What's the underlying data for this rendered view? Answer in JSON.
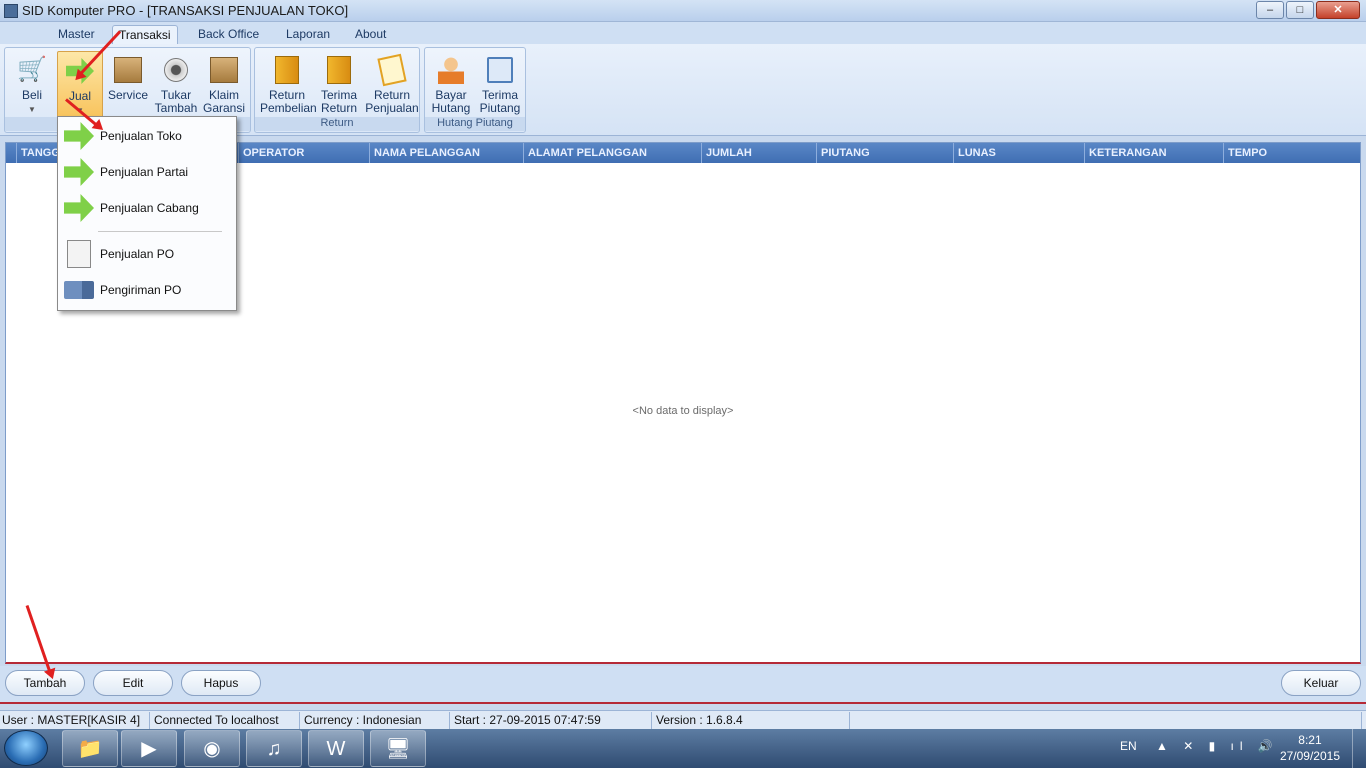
{
  "window": {
    "title": "SID Komputer PRO - [TRANSAKSI PENJUALAN TOKO]",
    "minimize": "–",
    "maximize": "□",
    "close": "✕"
  },
  "menu_tabs": [
    "Master",
    "Transaksi",
    "Back Office",
    "Laporan",
    "About"
  ],
  "ribbon": {
    "penjualan": {
      "buttons": [
        {
          "label1": "Beli",
          "label2": ""
        },
        {
          "label1": "Jual",
          "label2": ""
        },
        {
          "label1": "Service",
          "label2": ""
        },
        {
          "label1": "Tukar",
          "label2": "Tambah"
        },
        {
          "label1": "Klaim",
          "label2": "Garansi"
        }
      ]
    },
    "return": {
      "label": "Return",
      "buttons": [
        {
          "label1": "Return",
          "label2": "Pembelian"
        },
        {
          "label1": "Terima",
          "label2": "Return"
        },
        {
          "label1": "Return",
          "label2": "Penjualan"
        }
      ]
    },
    "hutang": {
      "label": "Hutang Piutang",
      "buttons": [
        {
          "label1": "Bayar",
          "label2": "Hutang"
        },
        {
          "label1": "Terima",
          "label2": "Piutang"
        }
      ]
    }
  },
  "jual_menu": {
    "items": [
      "Penjualan Toko",
      "Penjualan Partai",
      "Penjualan Cabang",
      "Penjualan PO",
      "Pengiriman PO"
    ]
  },
  "grid": {
    "columns": [
      "TANGGAL",
      "OPERATOR",
      "NAMA PELANGGAN",
      "ALAMAT PELANGGAN",
      "JUMLAH",
      "PIUTANG",
      "LUNAS",
      "KETERANGAN",
      "TEMPO"
    ],
    "empty_text": "<No data to display>"
  },
  "buttons": {
    "tambah": "Tambah",
    "edit": "Edit",
    "hapus": "Hapus",
    "keluar": "Keluar"
  },
  "status": {
    "user": "User : MASTER[KASIR 4]",
    "connection": "Connected To localhost",
    "currency": "Currency : Indonesian",
    "start": "Start  : 27-09-2015 07:47:59",
    "version": "Version : 1.6.8.4"
  },
  "taskbar": {
    "lang": "EN",
    "time": "8:21",
    "date": "27/09/2015",
    "apps": [
      "folder-icon",
      "media-player-icon",
      "firefox-icon",
      "itunes-icon",
      "word-icon",
      "computer-icon"
    ]
  }
}
